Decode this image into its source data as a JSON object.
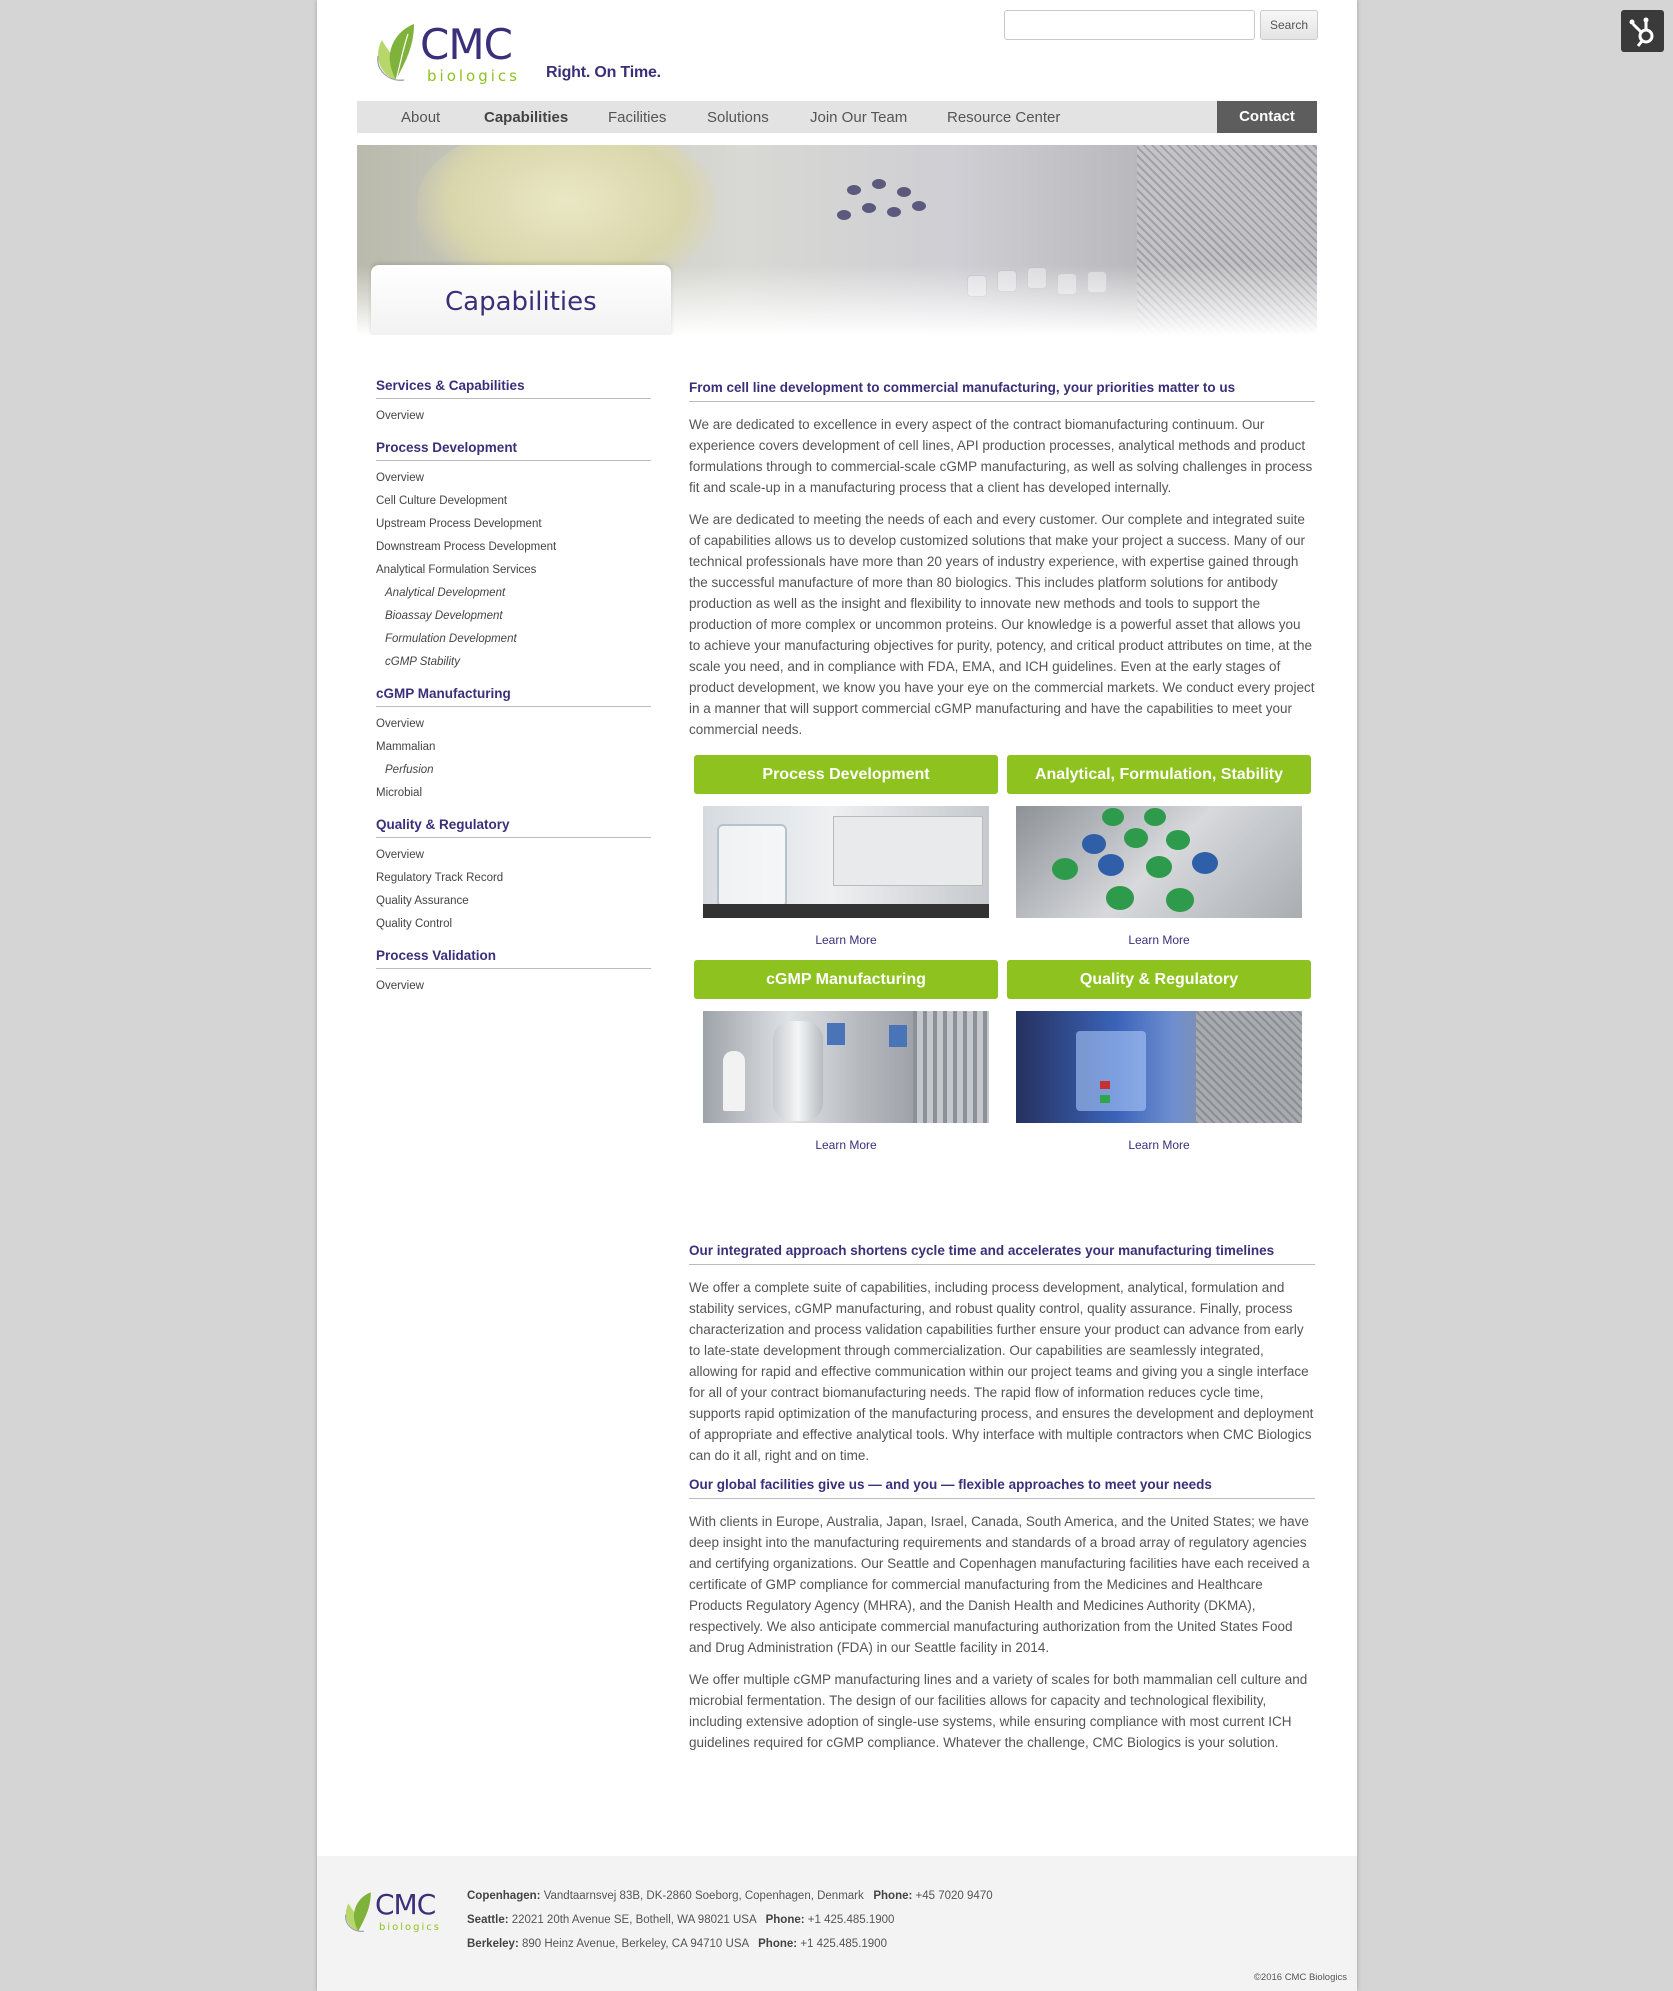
{
  "header": {
    "logo_text": "CMC",
    "logo_subtext": "biologics",
    "tagline": "Right. On Time.",
    "search_placeholder": "",
    "search_button": "Search"
  },
  "nav": {
    "items": [
      "About",
      "Capabilities",
      "Facilities",
      "Solutions",
      "Join Our Team",
      "Resource Center"
    ],
    "active": "Capabilities",
    "contact": "Contact"
  },
  "hero": {
    "title": "Capabilities"
  },
  "sidebar": {
    "sections": [
      {
        "heading": "Services & Capabilities",
        "links": [
          {
            "label": "Overview"
          }
        ]
      },
      {
        "heading": "Process Development",
        "links": [
          {
            "label": "Overview"
          },
          {
            "label": "Cell Culture Development"
          },
          {
            "label": "Upstream Process Development"
          },
          {
            "label": "Downstream Process Development"
          },
          {
            "label": "Analytical Formulation Services"
          },
          {
            "label": "Analytical Development",
            "sub": true
          },
          {
            "label": "Bioassay Development",
            "sub": true
          },
          {
            "label": "Formulation Development",
            "sub": true
          },
          {
            "label": "cGMP Stability",
            "sub": true
          }
        ]
      },
      {
        "heading": "cGMP Manufacturing",
        "links": [
          {
            "label": "Overview"
          },
          {
            "label": "Mammalian"
          },
          {
            "label": "Perfusion",
            "sub": true
          },
          {
            "label": "Microbial"
          }
        ]
      },
      {
        "heading": "Quality & Regulatory",
        "links": [
          {
            "label": "Overview"
          },
          {
            "label": "Regulatory Track Record"
          },
          {
            "label": "Quality Assurance"
          },
          {
            "label": "Quality Control"
          }
        ]
      },
      {
        "heading": "Process Validation",
        "links": [
          {
            "label": "Overview"
          }
        ]
      }
    ]
  },
  "main": {
    "heading1": "From cell line development to commercial manufacturing, your priorities matter to us",
    "para1": "We are dedicated to excellence in every aspect of the contract biomanufacturing continuum. Our experience covers development of cell lines, API production processes, analytical methods and product formulations through to commercial-scale cGMP manufacturing, as well as solving challenges in process fit and scale-up in a manufacturing process that a client has developed internally.",
    "para2": "We are dedicated to meeting the needs of each and every customer. Our complete and integrated suite of capabilities allows us to develop customized solutions that make your project a success. Many of our technical professionals have more than 20 years of industry experience, with expertise gained through the successful manufacture of more than 80 biologics. This includes platform solutions for antibody production as well as the insight and flexibility to innovate new methods and tools to support the production of more complex or uncommon proteins. Our knowledge is a powerful asset that allows you to achieve your manufacturing objectives for purity, potency, and critical product attributes on time, at the scale you need, and in compliance with FDA, EMA, and ICH guidelines. Even at the early stages of product development, we know you have your eye on the commercial markets. We conduct every project in a manner that will support commercial cGMP manufacturing and have the capabilities to meet your commercial needs.",
    "tiles": [
      {
        "title": "Process Development",
        "link": "Learn More"
      },
      {
        "title": "Analytical, Formulation, Stability",
        "link": "Learn More"
      },
      {
        "title": "cGMP Manufacturing",
        "link": "Learn More"
      },
      {
        "title": "Quality & Regulatory",
        "link": "Learn More"
      }
    ],
    "heading2": "Our integrated approach shortens cycle time and accelerates your manufacturing timelines",
    "para3": "We offer a complete suite of capabilities, including process development, analytical, formulation and stability services, cGMP manufacturing, and robust quality control, quality assurance. Finally, process characterization and process validation capabilities further ensure your product can advance from early to late-state development through commercialization. Our capabilities are seamlessly integrated, allowing for rapid and effective communication within our project teams and giving you a single interface for all of your contract biomanufacturing needs. The rapid flow of information reduces cycle time, supports rapid optimization of the manufacturing process, and ensures the development and deployment of appropriate and effective analytical tools. Why interface with multiple contractors when CMC Biologics can do it all, right and on time.",
    "heading3": "Our global facilities give us — and you — flexible approaches to meet your needs",
    "para4": "With clients in Europe, Australia, Japan, Israel, Canada, South America, and the United States; we have deep insight into the manufacturing requirements and standards of a broad array of regulatory agencies and certifying organizations. Our Seattle and Copenhagen manufacturing facilities have each received a certificate of GMP compliance for commercial manufacturing from the Medicines and Healthcare Products Regulatory Agency (MHRA), and the Danish Health and Medicines Authority (DKMA), respectively. We also anticipate commercial manufacturing authorization from the United States Food and Drug Administration (FDA) in our Seattle facility in 2014.",
    "para5": "We offer multiple cGMP manufacturing lines and a variety of scales for both mammalian cell culture and microbial fermentation. The design of our facilities allows for capacity and technological flexibility, including extensive adoption of single-use systems, while ensuring compliance with most current ICH guidelines required for cGMP compliance. Whatever the challenge, CMC Biologics is your solution."
  },
  "footer": {
    "logo_text": "CMC",
    "logo_subtext": "biologics",
    "locations": [
      {
        "city": "Copenhagen:",
        "address": "Vandtaarnsvej 83B, DK-2860 Soeborg, Copenhagen, Denmark",
        "phone_label": "Phone:",
        "phone": "+45 7020 9470"
      },
      {
        "city": "Seattle:",
        "address": "22021 20th Avenue SE, Bothell, WA 98021 USA",
        "phone_label": "Phone:",
        "phone": "+1 425.485.1900"
      },
      {
        "city": "Berkeley:",
        "address": "890 Heinz Avenue, Berkeley, CA 94710 USA",
        "phone_label": "Phone:",
        "phone": "+1 425.485.1900"
      }
    ],
    "copyright": "©2016 CMC Biologics"
  },
  "colors": {
    "brand_purple": "#3c2f7a",
    "brand_green": "#8dc21f",
    "nav_gray": "#e3e3e3",
    "contact_bg": "#5d5d5d"
  },
  "icons": {
    "hubspot": "hubspot-sprocket-icon",
    "logo": "leaf-logo-icon"
  }
}
